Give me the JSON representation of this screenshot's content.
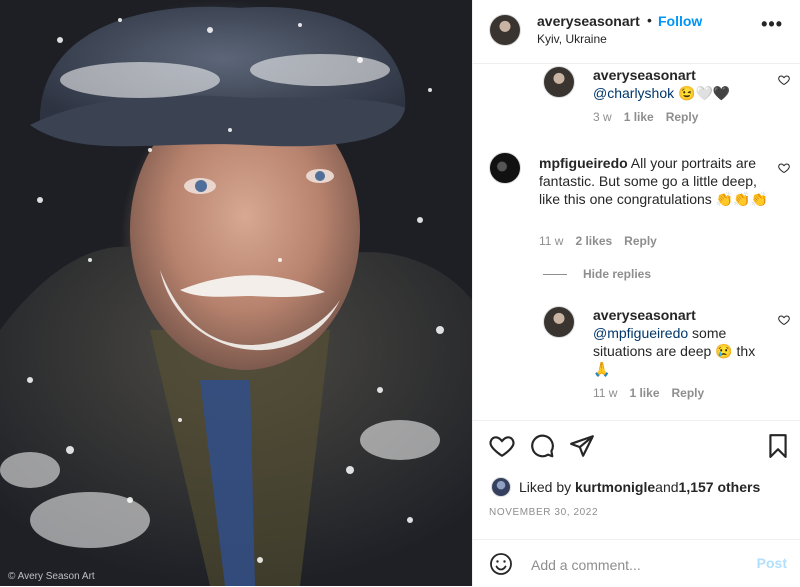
{
  "photo": {
    "alt": "portrait of an elderly man in snow",
    "credit": "© Avery Season Art"
  },
  "header": {
    "username": "averyseasonart",
    "separator": "•",
    "follow_label": "Follow",
    "location": "Kyiv, Ukraine",
    "more_icon": "more-horizontal-icon"
  },
  "comments": [
    {
      "username": "averyseasonart",
      "mention": "@charlyshok",
      "text": " 😉🤍🖤",
      "age": "3 w",
      "likes": "1 like",
      "reply": "Reply"
    },
    {
      "username": "mpfigueiredo",
      "text": " All your portraits are fantastic. But some go a little deep, like this one congratulations 👏👏👏",
      "age": "11 w",
      "likes": "2 likes",
      "reply": "Reply",
      "hide_replies": "Hide replies"
    },
    {
      "username": "averyseasonart",
      "mention": "@mpfigueiredo",
      "text": " some situations are deep 😢 thx 🙏",
      "age": "11 w",
      "likes": "1 like",
      "reply": "Reply"
    }
  ],
  "actions": {
    "like_icon": "heart-icon",
    "comment_icon": "comment-icon",
    "share_icon": "share-icon",
    "save_icon": "bookmark-icon"
  },
  "likes": {
    "prefix": "Liked by ",
    "user": "kurtmonigle",
    "middle": " and ",
    "count": "1,157 others"
  },
  "date": "NOVEMBER 30, 2022",
  "add_comment": {
    "placeholder": "Add a comment...",
    "post_label": "Post",
    "emoji_icon": "emoji-icon"
  },
  "colors": {
    "accent": "#0095f6",
    "post_disabled": "#b2dffc",
    "mention": "#00376b",
    "muted": "#8e8e8e"
  }
}
